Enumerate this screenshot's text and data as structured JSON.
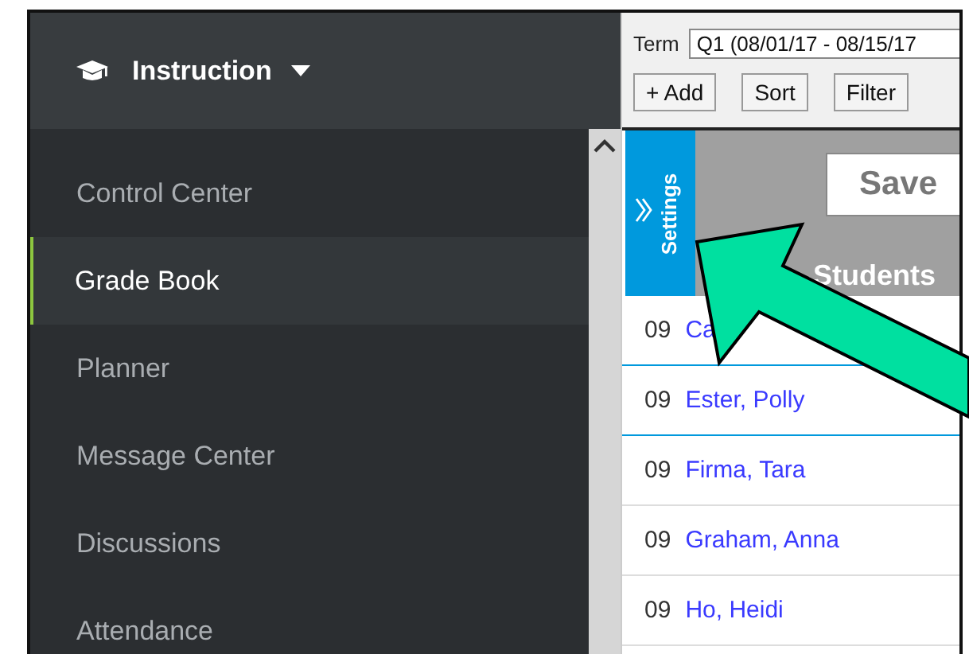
{
  "header": {
    "title": "Instruction"
  },
  "sidebar": {
    "items": [
      {
        "label": "Control Center",
        "selected": false
      },
      {
        "label": "Grade Book",
        "selected": true
      },
      {
        "label": "Planner",
        "selected": false
      },
      {
        "label": "Message Center",
        "selected": false
      },
      {
        "label": "Discussions",
        "selected": false
      },
      {
        "label": "Attendance",
        "selected": false
      }
    ]
  },
  "toolbar": {
    "term_label": "Term",
    "term_value": "Q1 (08/01/17 - 08/15/17",
    "buttons": [
      "+ Add",
      "Sort",
      "Filter"
    ]
  },
  "settings_tab": "Settings",
  "save_button": "Save",
  "table": {
    "column": "Students",
    "rows": [
      {
        "grade": "09",
        "name": "Ca",
        "selected": false
      },
      {
        "grade": "09",
        "name": "Ester, Polly",
        "selected": true
      },
      {
        "grade": "09",
        "name": "Firma, Tara",
        "selected": false
      },
      {
        "grade": "09",
        "name": "Graham, Anna",
        "selected": false
      },
      {
        "grade": "09",
        "name": "Ho, Heidi",
        "selected": false
      }
    ]
  }
}
